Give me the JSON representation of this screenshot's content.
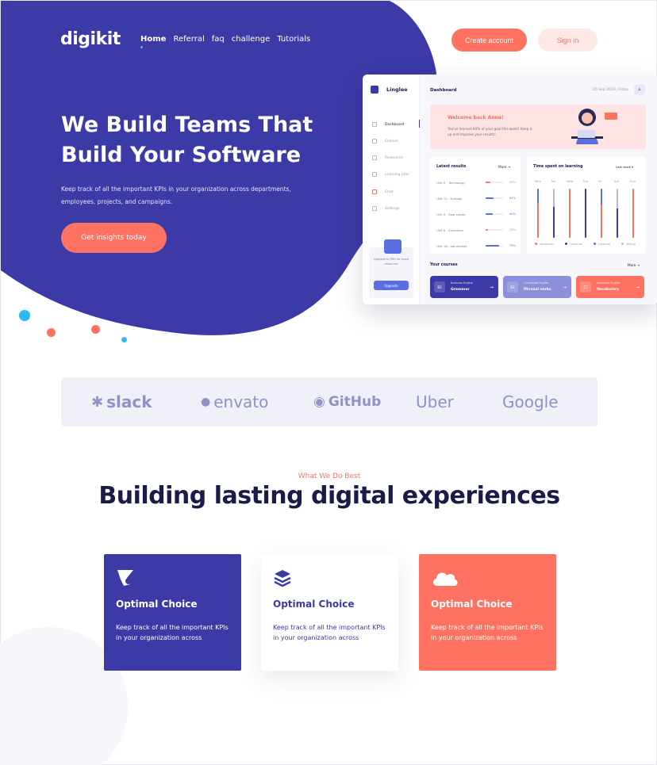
{
  "brand": "digikit",
  "nav": [
    {
      "label": "Home",
      "active": true
    },
    {
      "label": "Referral"
    },
    {
      "label": "faq"
    },
    {
      "label": "challenge"
    },
    {
      "label": "Tutorials"
    }
  ],
  "header": {
    "create_account": "Create account",
    "sign_in": "Sign in"
  },
  "hero": {
    "title": "We Build Teams That Build Your Software",
    "subtitle": "Keep track of all the important KPIs in your organization across departments, employees, projects, and campaigns.",
    "cta": "Get insights today"
  },
  "dashboard": {
    "app_name": "Linglee",
    "title": "Dashboard",
    "date": "20 Sep 2019, Friday",
    "sidebar": [
      {
        "label": "Dashboard",
        "active": true,
        "icon": "grid-icon"
      },
      {
        "label": "Classes",
        "icon": "folder-icon"
      },
      {
        "label": "Resources",
        "icon": "file-icon"
      },
      {
        "label": "Learning plan",
        "icon": "calendar-icon"
      },
      {
        "label": "Chat",
        "icon": "chat-icon"
      },
      {
        "label": "Settings",
        "icon": "edit-icon"
      }
    ],
    "upgrade": {
      "text": "Upgrade to PRO for more resources",
      "button": "Upgrade"
    },
    "welcome": {
      "title": "Welcome back Anna!",
      "text": "You've learned 80% of your goal this week! Keep it up and improve your results!"
    },
    "latest": {
      "title": "Latest results",
      "more": "More",
      "rows": [
        {
          "label": "Unit 5 - Technology",
          "pct": "25%",
          "value": 0.25,
          "color": "#ff7262"
        },
        {
          "label": "Unit 12 - Ecology",
          "pct": "44%",
          "value": 0.44,
          "color": "#5b6ee0"
        },
        {
          "label": "Unit 9 - Real estate",
          "pct": "40%",
          "value": 0.4,
          "color": "#5b6ee0"
        },
        {
          "label": "Unit 8 - Education",
          "pct": "15%",
          "value": 0.15,
          "color": "#ff7262"
        },
        {
          "label": "Unit 16 - Job market",
          "pct": "75%",
          "value": 0.75,
          "color": "#5b6ee0"
        }
      ]
    },
    "time": {
      "title": "Time spent on learning",
      "filter": "Last week",
      "days": [
        "Mon",
        "Tue",
        "Wed",
        "Thu",
        "Fri",
        "Sat",
        "Sun"
      ],
      "legend": [
        {
          "label": "Vocabulary",
          "color": "#ff7262"
        },
        {
          "label": "Grammar",
          "color": "#3b3aa6"
        },
        {
          "label": "Listening",
          "color": "#5b6ee0"
        },
        {
          "label": "Writing",
          "color": "#b7b9e8"
        }
      ]
    },
    "courses": {
      "title": "Your courses",
      "more": "More",
      "items": [
        {
          "num": "B2",
          "label": "Business English",
          "name": "Grammar",
          "color": "#3b3aa6"
        },
        {
          "num": "B2",
          "label": "Connected English",
          "name": "Phrasal verbs",
          "color": "#8c8fd9"
        },
        {
          "num": "C1",
          "label": "American English",
          "name": "Vocabulary",
          "color": "#ff7262"
        }
      ]
    }
  },
  "partners": [
    "slack",
    "envato",
    "GitHub",
    "Uber",
    "Google"
  ],
  "section": {
    "kicker": "What We Do Best",
    "title": "Building lasting digital experiences",
    "cards": [
      {
        "title": "Optimal Choice",
        "desc": "Keep track of all the important KPIs in your organization across",
        "icon": "shield-icon",
        "bg": "#3b3aa6",
        "fg": "#ffffff"
      },
      {
        "title": "Optimal Choice",
        "desc": "Keep track of all the important KPIs in your organization across",
        "icon": "layers-icon",
        "bg": "#ffffff",
        "fg": "#3b3aa6"
      },
      {
        "title": "Optimal Choice",
        "desc": "Keep track of all the important KPIs in your organization across",
        "icon": "cloud-icon",
        "bg": "#ff7262",
        "fg": "#ffffff"
      }
    ]
  },
  "colors": {
    "primary": "#3b3aa6",
    "accent": "#ff7262",
    "dot_blue": "#2bbaf7"
  }
}
